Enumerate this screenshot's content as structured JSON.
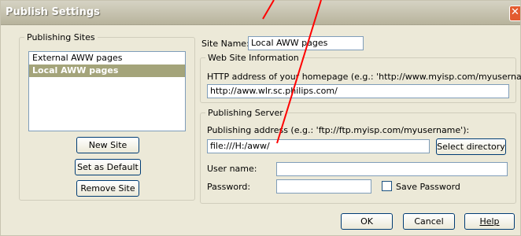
{
  "window": {
    "title": "Publish Settings",
    "close_icon": "close-icon"
  },
  "publishing_sites": {
    "legend": "Publishing Sites",
    "items": [
      {
        "label": "External AWW pages",
        "selected": false
      },
      {
        "label": "Local AWW pages",
        "selected": true
      }
    ],
    "new_site_label": "New Site",
    "set_default_label": "Set as Default",
    "remove_site_label": "Remove Site"
  },
  "site_name": {
    "label": "Site Name:",
    "value": "Local AWW pages"
  },
  "web_site_info": {
    "legend": "Web Site Information",
    "http_label": "HTTP address of your homepage (e.g.: 'http://www.myisp.com/myusername'):",
    "http_value": "http://aww.wlr.sc.philips.com/"
  },
  "publishing_server": {
    "legend": "Publishing Server",
    "address_label": "Publishing address (e.g.: 'ftp://ftp.myisp.com/myusername'):",
    "address_value": "file:///H:/aww/",
    "select_directory_label": "Select directory",
    "user_name_label": "User name:",
    "user_name_value": "",
    "password_label": "Password:",
    "password_value": "",
    "save_password_label": "Save Password",
    "save_password_checked": false
  },
  "footer": {
    "ok_label": "OK",
    "cancel_label": "Cancel",
    "help_label": "Help"
  },
  "colors": {
    "annotation_arrow": "#ff0000",
    "selected_item": "#a4a47a",
    "dialog_bg": "#ece9d8"
  }
}
